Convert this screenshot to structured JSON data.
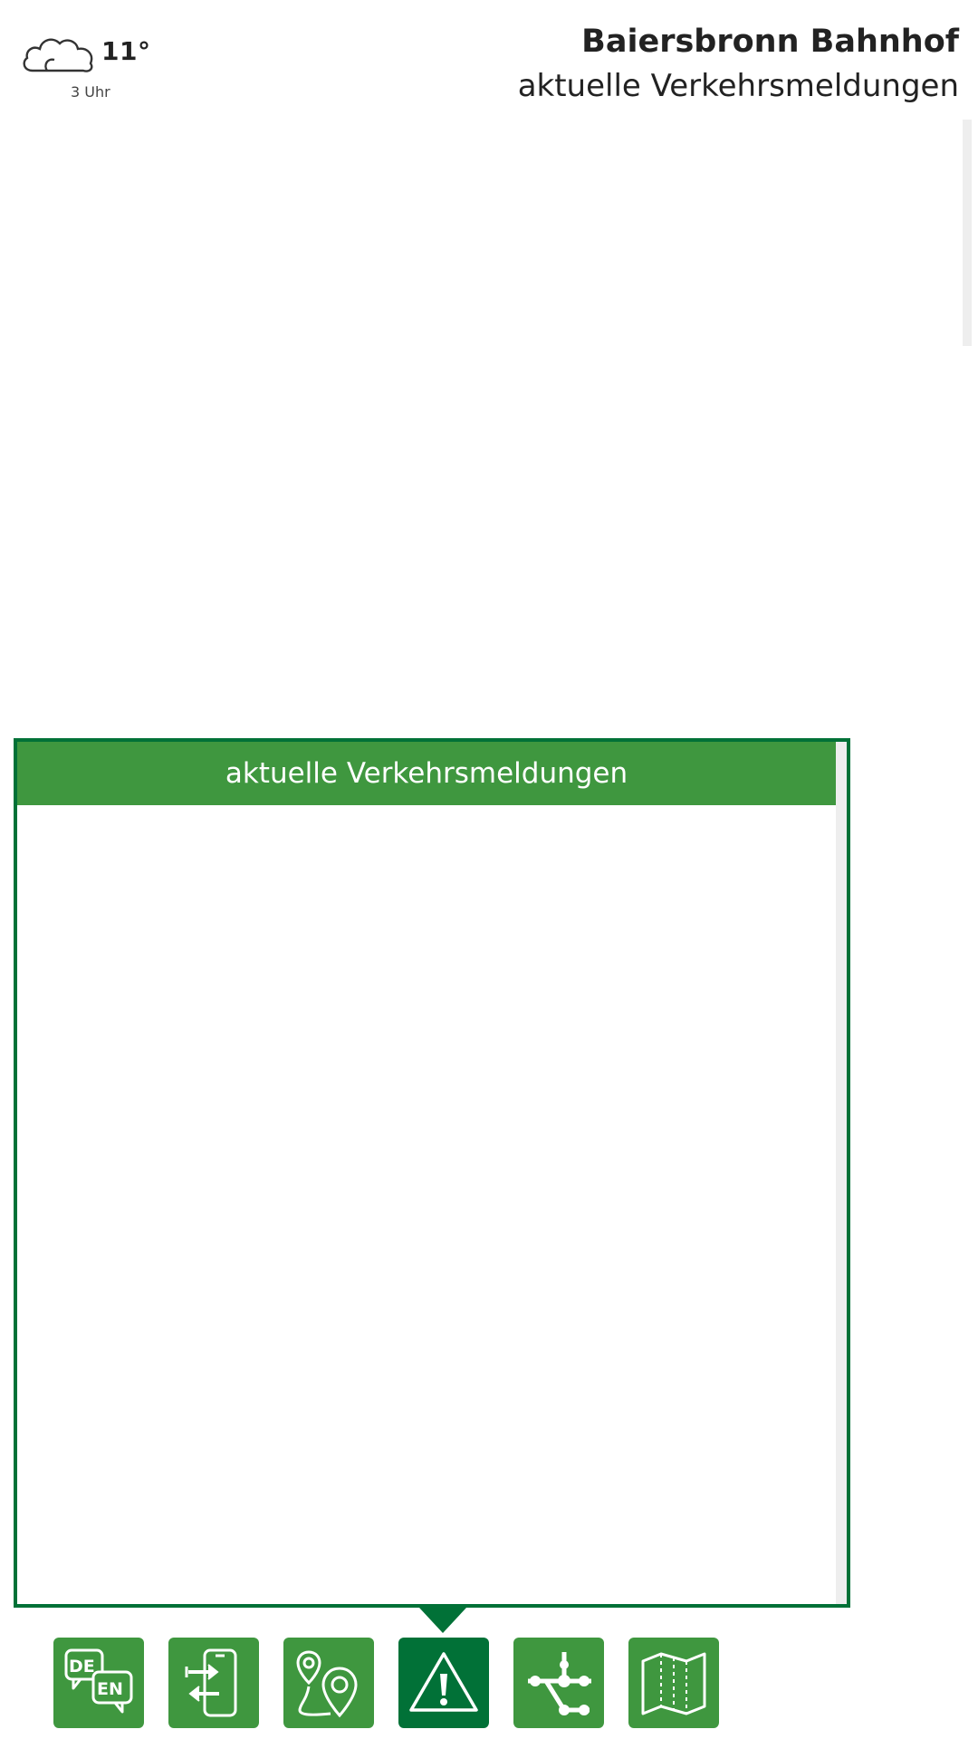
{
  "weather": {
    "temperature": "11°",
    "time": "3 Uhr",
    "icon": "cloud-icon"
  },
  "header": {
    "station": "Baiersbronn Bahnhof",
    "subtitle": "aktuelle Verkehrsmeldungen"
  },
  "panel": {
    "title": "aktuelle Verkehrsmeldungen"
  },
  "nav": {
    "language": {
      "de": "DE",
      "en": "EN",
      "icon": "language-de-en-icon"
    },
    "items": [
      {
        "name": "language",
        "icon": "language-de-en-icon",
        "active": false
      },
      {
        "name": "transfer",
        "icon": "phone-transfer-icon",
        "active": false
      },
      {
        "name": "route",
        "icon": "route-pin-icon",
        "active": false
      },
      {
        "name": "alerts",
        "icon": "warning-icon",
        "active": true
      },
      {
        "name": "network",
        "icon": "network-icon",
        "active": false
      },
      {
        "name": "map",
        "icon": "map-icon",
        "active": false
      }
    ]
  },
  "colors": {
    "primary_green": "#3f973f",
    "active_green": "#017137",
    "text": "#222222"
  }
}
